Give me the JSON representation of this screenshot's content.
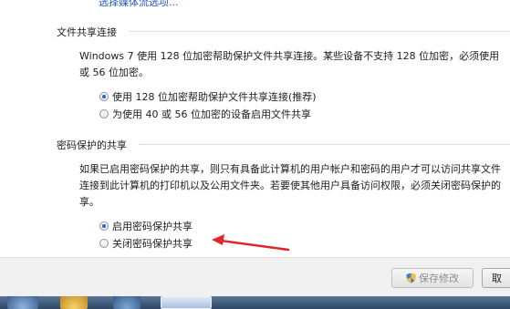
{
  "top_link": {
    "text": "选择媒体流选项..."
  },
  "file_sharing": {
    "title": "文件共享连接",
    "desc_line1": "Windows 7 使用 128 位加密帮助保护文件共享连接。某些设备不支持 128 位加密，必须使用",
    "desc_line2": "或 56 位加密。",
    "options": [
      {
        "label": "使用 128 位加密帮助保护文件共享连接(推荐)",
        "selected": true
      },
      {
        "label": "为使用 40 或 56 位加密的设备启用文件共享",
        "selected": false
      }
    ]
  },
  "password_sharing": {
    "title": "密码保护的共享",
    "desc_line1": "如果已启用密码保护的共享，则只有具备此计算机的用户帐户和密码的用户才可以访问共享文件",
    "desc_line2": "连接到此计算机的打印机以及公用文件夹。若要使其他用户具备访问权限，必须关闭密码保护的",
    "desc_line3": "享。",
    "options": [
      {
        "label": "启用密码保护共享",
        "selected": true
      },
      {
        "label": "关闭密码保护共享",
        "selected": false
      }
    ]
  },
  "footer": {
    "save_label": "保存修改",
    "cancel_label": "取"
  },
  "colors": {
    "annotation_arrow": "#e0262b",
    "link": "#1f55c0"
  }
}
